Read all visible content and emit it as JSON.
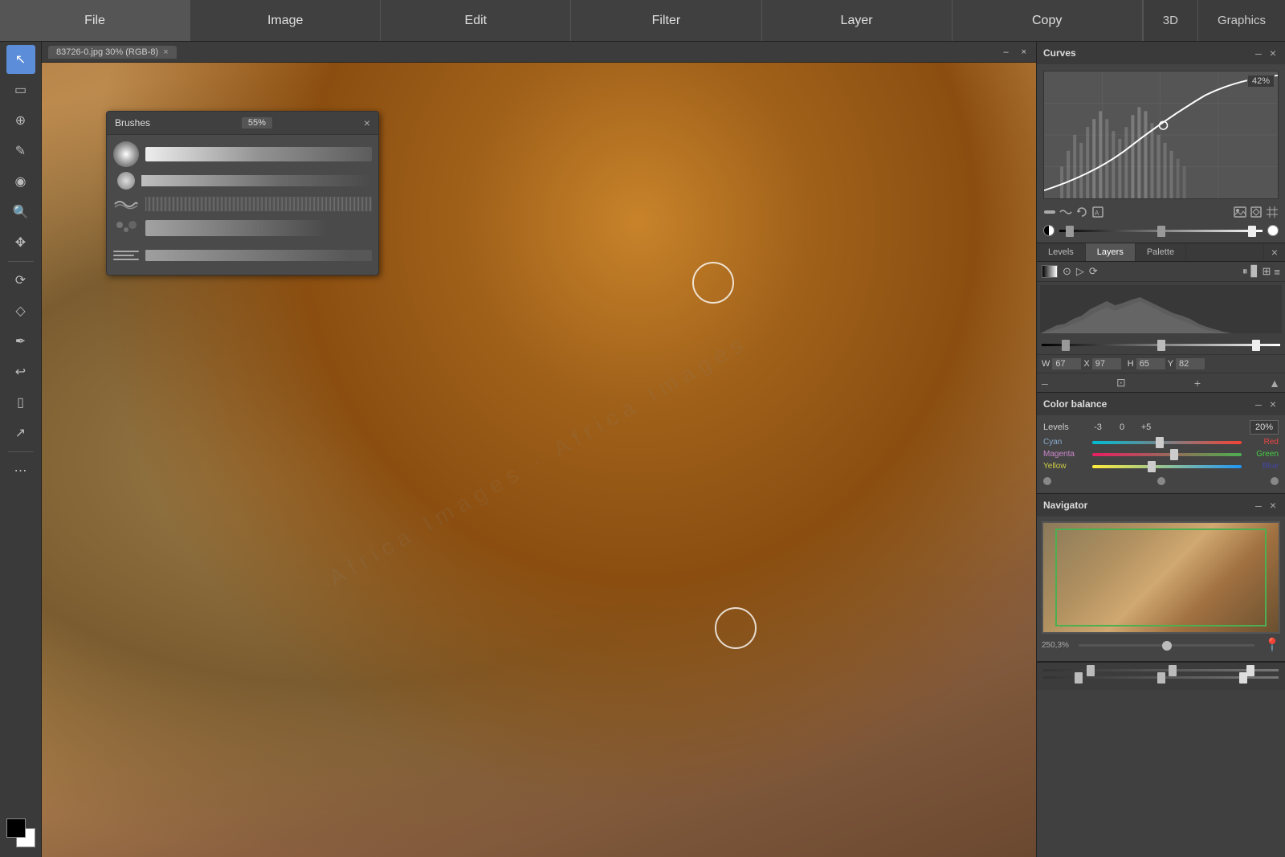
{
  "menubar": {
    "items": [
      "File",
      "Image",
      "Edit",
      "Filter",
      "Layer",
      "Copy"
    ],
    "right_items": [
      "3D",
      "Graphics"
    ]
  },
  "canvas": {
    "tab_label": "83726-0.jpg 30% (RGB-8)",
    "close_btn": "×",
    "minimize_btn": "–"
  },
  "brushes_panel": {
    "title": "Brushes",
    "percent": "55%",
    "close": "×"
  },
  "curves_panel": {
    "title": "Curves",
    "percent_label": "42%",
    "close": "×",
    "minimize": "–"
  },
  "layers_tabs": {
    "tabs": [
      "Levels",
      "Layers",
      "Palette"
    ],
    "active": "Layers"
  },
  "layers_info": {
    "w_label": "W",
    "w_value": "67",
    "x_label": "X",
    "x_value": "97",
    "h_label": "H",
    "h_value": "65",
    "y_label": "Y",
    "y_value": "82"
  },
  "color_balance": {
    "title": "Color balance",
    "close": "×",
    "minimize": "–",
    "levels_label": "Levels",
    "val1": "-3",
    "val2": "0",
    "val3": "+5",
    "percent_label": "20%",
    "cyan_label": "Cyan",
    "red_label": "Red",
    "magenta_label": "Magenta",
    "green_label": "Green",
    "yellow_label": "Yellow",
    "blue_label": "Blue",
    "cyan_thumb_pos": "45%",
    "magenta_thumb_pos": "55%",
    "yellow_thumb_pos": "40%"
  },
  "navigator": {
    "title": "Navigator",
    "close": "×",
    "minimize": "–",
    "zoom_label": "250,3%"
  },
  "tools": {
    "list": [
      "↖",
      "▭",
      "⊕",
      "✎",
      "◉",
      "🔍",
      "✥",
      "⟳",
      "🔷",
      "✏",
      "↩",
      "▯",
      "↗",
      "⋯",
      "⬛"
    ]
  }
}
